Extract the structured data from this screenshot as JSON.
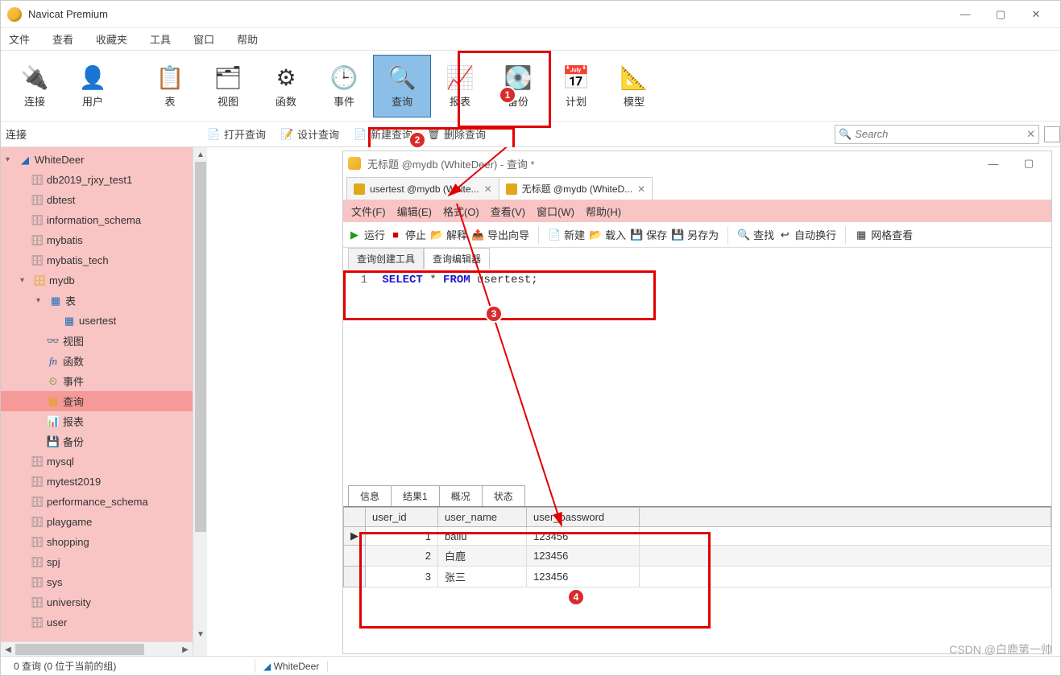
{
  "app": {
    "title": "Navicat Premium"
  },
  "menu": {
    "items": [
      "文件",
      "查看",
      "收藏夹",
      "工具",
      "窗口",
      "帮助"
    ]
  },
  "ribbon": {
    "items": [
      {
        "label": "连接",
        "emoji": "🔌"
      },
      {
        "label": "用户",
        "emoji": "👤"
      },
      {
        "label": "表",
        "emoji": "📋"
      },
      {
        "label": "视图",
        "emoji": "🗂"
      },
      {
        "label": "函数",
        "emoji": "⚙"
      },
      {
        "label": "事件",
        "emoji": "🕒"
      },
      {
        "label": "查询",
        "emoji": "🔍",
        "highlight": true
      },
      {
        "label": "报表",
        "emoji": "📈"
      },
      {
        "label": "备份",
        "emoji": "💽"
      },
      {
        "label": "计划",
        "emoji": "📅"
      },
      {
        "label": "模型",
        "emoji": "📐"
      }
    ]
  },
  "subbar": {
    "conn_label": "连接",
    "tools": [
      {
        "label": "打开查询"
      },
      {
        "label": "设计查询"
      },
      {
        "label": "新建查询"
      },
      {
        "label": "删除查询"
      }
    ],
    "search_placeholder": "Search"
  },
  "tree": {
    "root": "WhiteDeer",
    "children": [
      {
        "label": "db2019_rjxy_test1",
        "ic": "db"
      },
      {
        "label": "dbtest",
        "ic": "db"
      },
      {
        "label": "information_schema",
        "ic": "db"
      },
      {
        "label": "mybatis",
        "ic": "db"
      },
      {
        "label": "mybatis_tech",
        "ic": "db"
      },
      {
        "label": "mydb",
        "ic": "db-open",
        "open": true,
        "children": [
          {
            "label": "表",
            "ic": "tbl",
            "open": true,
            "children": [
              {
                "label": "usertest",
                "ic": "tbl"
              }
            ]
          },
          {
            "label": "视图",
            "ic": "view"
          },
          {
            "label": "函数",
            "ic": "fn"
          },
          {
            "label": "事件",
            "ic": "evt"
          },
          {
            "label": "查询",
            "ic": "qry",
            "selected": true
          },
          {
            "label": "报表",
            "ic": "rpt"
          },
          {
            "label": "备份",
            "ic": "bk"
          }
        ]
      },
      {
        "label": "mysql",
        "ic": "db"
      },
      {
        "label": "mytest2019",
        "ic": "db"
      },
      {
        "label": "performance_schema",
        "ic": "db"
      },
      {
        "label": "playgame",
        "ic": "db"
      },
      {
        "label": "shopping",
        "ic": "db"
      },
      {
        "label": "spj",
        "ic": "db"
      },
      {
        "label": "sys",
        "ic": "db"
      },
      {
        "label": "university",
        "ic": "db"
      },
      {
        "label": "user",
        "ic": "db"
      }
    ]
  },
  "query_window": {
    "title": "无标题 @mydb (WhiteDeer) - 查询 *",
    "tabs": [
      {
        "label": "usertest @mydb (White...",
        "active": false
      },
      {
        "label": "无标题 @mydb (WhiteD...",
        "active": true
      }
    ],
    "menu": [
      "文件(F)",
      "编辑(E)",
      "格式(O)",
      "查看(V)",
      "窗口(W)",
      "帮助(H)"
    ],
    "toolbar": [
      {
        "label": "运行",
        "ic": "play"
      },
      {
        "label": "停止",
        "ic": "stop"
      },
      {
        "label": "解释",
        "ic": "fld"
      },
      {
        "label": "导出向导",
        "ic": "fld"
      },
      {
        "sep": true
      },
      {
        "label": "新建",
        "ic": "fld"
      },
      {
        "label": "载入",
        "ic": "fld"
      },
      {
        "label": "保存",
        "ic": "fld"
      },
      {
        "label": "另存为",
        "ic": "fld"
      },
      {
        "sep": true
      },
      {
        "label": "查找",
        "ic": "fld"
      },
      {
        "label": "自动换行",
        "ic": "fld"
      },
      {
        "sep": true
      },
      {
        "label": "网格查看",
        "ic": "fld"
      }
    ],
    "subtabs": [
      "查询创建工具",
      "查询编辑器"
    ],
    "editor": {
      "line": "1",
      "kw1": "SELECT",
      "star": "*",
      "kw2": "FROM",
      "rest": " usertest;"
    },
    "result_tabs": [
      "信息",
      "结果1",
      "概况",
      "状态"
    ],
    "columns": [
      "user_id",
      "user_name",
      "user_password"
    ],
    "rows": [
      {
        "user_id": "1",
        "user_name": "bailu",
        "user_password": "123456"
      },
      {
        "user_id": "2",
        "user_name": "白鹿",
        "user_password": "123456"
      },
      {
        "user_id": "3",
        "user_name": "张三",
        "user_password": "123456"
      }
    ]
  },
  "status": {
    "left": "0 查询 (0 位于当前的组)",
    "conn": "WhiteDeer"
  },
  "annotations": {
    "b1": "1",
    "b2": "2",
    "b3": "3",
    "b4": "4"
  },
  "watermark": "CSDN @白鹿第一帅"
}
